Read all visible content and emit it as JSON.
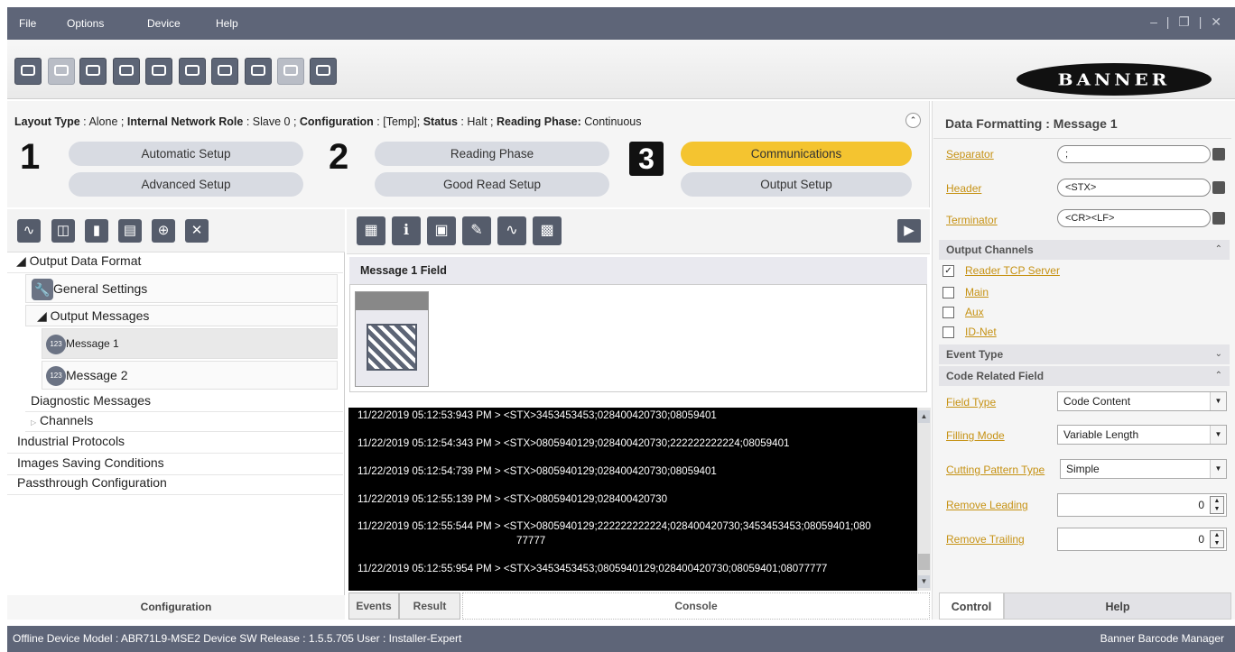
{
  "menu": {
    "file": "File",
    "options": "Options",
    "device": "Device",
    "help": "Help"
  },
  "window_controls": "– | ❐ | ✕",
  "logo_text": "BANNER",
  "info": {
    "layout_label": "Layout Type",
    "layout_val": "Alone",
    "role_label": "Internal Network Role",
    "role_val": "Slave 0",
    "config_label": "Configuration",
    "config_val": "[Temp]",
    "status_label": "Status",
    "status_val": "Halt",
    "phase_label": "Reading Phase:",
    "phase_val": "Continuous"
  },
  "steps": {
    "n1": "1",
    "n2": "2",
    "n3": "3",
    "automatic_setup": "Automatic Setup",
    "advanced_setup": "Advanced Setup",
    "reading_phase": "Reading Phase",
    "good_read_setup": "Good Read Setup",
    "communications": "Communications",
    "output_setup": "Output Setup"
  },
  "tree": {
    "output_data_format": "Output Data Format",
    "general_settings": "General Settings",
    "output_messages": "Output Messages",
    "message1": "Message 1",
    "message2": "Message 2",
    "diagnostic_messages": "Diagnostic Messages",
    "channels": "Channels",
    "industrial_protocols": "Industrial Protocols",
    "images_saving": "Images Saving Conditions",
    "passthrough": "Passthrough Configuration"
  },
  "left_footer": "Configuration",
  "message_field_header": "Message 1 Field",
  "console_lines": [
    "11/22/2019 05:12:53:943 PM > <STX>3453453453;028400420730;08059401",
    "11/22/2019 05:12:54:343 PM > <STX>0805940129;028400420730;222222222224;08059401",
    "11/22/2019 05:12:54:739 PM > <STX>0805940129;028400420730;08059401",
    "11/22/2019 05:12:55:139 PM > <STX>0805940129;028400420730",
    "11/22/2019 05:12:55:544 PM > <STX>0805940129;222222222224;028400420730;3453453453;08059401;080",
    "77777",
    "11/22/2019 05:12:55:954 PM > <STX>3453453453;0805940129;028400420730;08059401;08077777"
  ],
  "mid_tabs": {
    "events": "Events",
    "result": "Result",
    "console": "Console"
  },
  "right": {
    "title": "Data Formatting :  Message 1",
    "separator_label": "Separator",
    "separator_val": ";",
    "header_label": "Header",
    "header_val": "<STX>",
    "terminator_label": "Terminator",
    "terminator_val": "<CR><LF>",
    "output_channels": "Output Channels",
    "ch_reader_tcp": "Reader TCP Server",
    "ch_main": "Main",
    "ch_aux": "Aux",
    "ch_idnet": "ID-Net",
    "event_type": "Event Type",
    "code_related_field": "Code Related Field",
    "field_type_label": "Field Type",
    "field_type_val": "Code Content",
    "filling_mode_label": "Filling Mode",
    "filling_mode_val": "Variable Length",
    "cutting_label": "Cutting Pattern Type",
    "cutting_val": "Simple",
    "remove_leading_label": "Remove Leading",
    "remove_leading_val": "0",
    "remove_trailing_label": "Remove Trailing",
    "remove_trailing_val": "0",
    "tab_control": "Control",
    "tab_help": "Help"
  },
  "status": {
    "left": "Offline Device Model : ABR71L9-MSE2   Device SW Release : 1.5.5.705   User : Installer-Expert",
    "right": "Banner Barcode Manager"
  }
}
